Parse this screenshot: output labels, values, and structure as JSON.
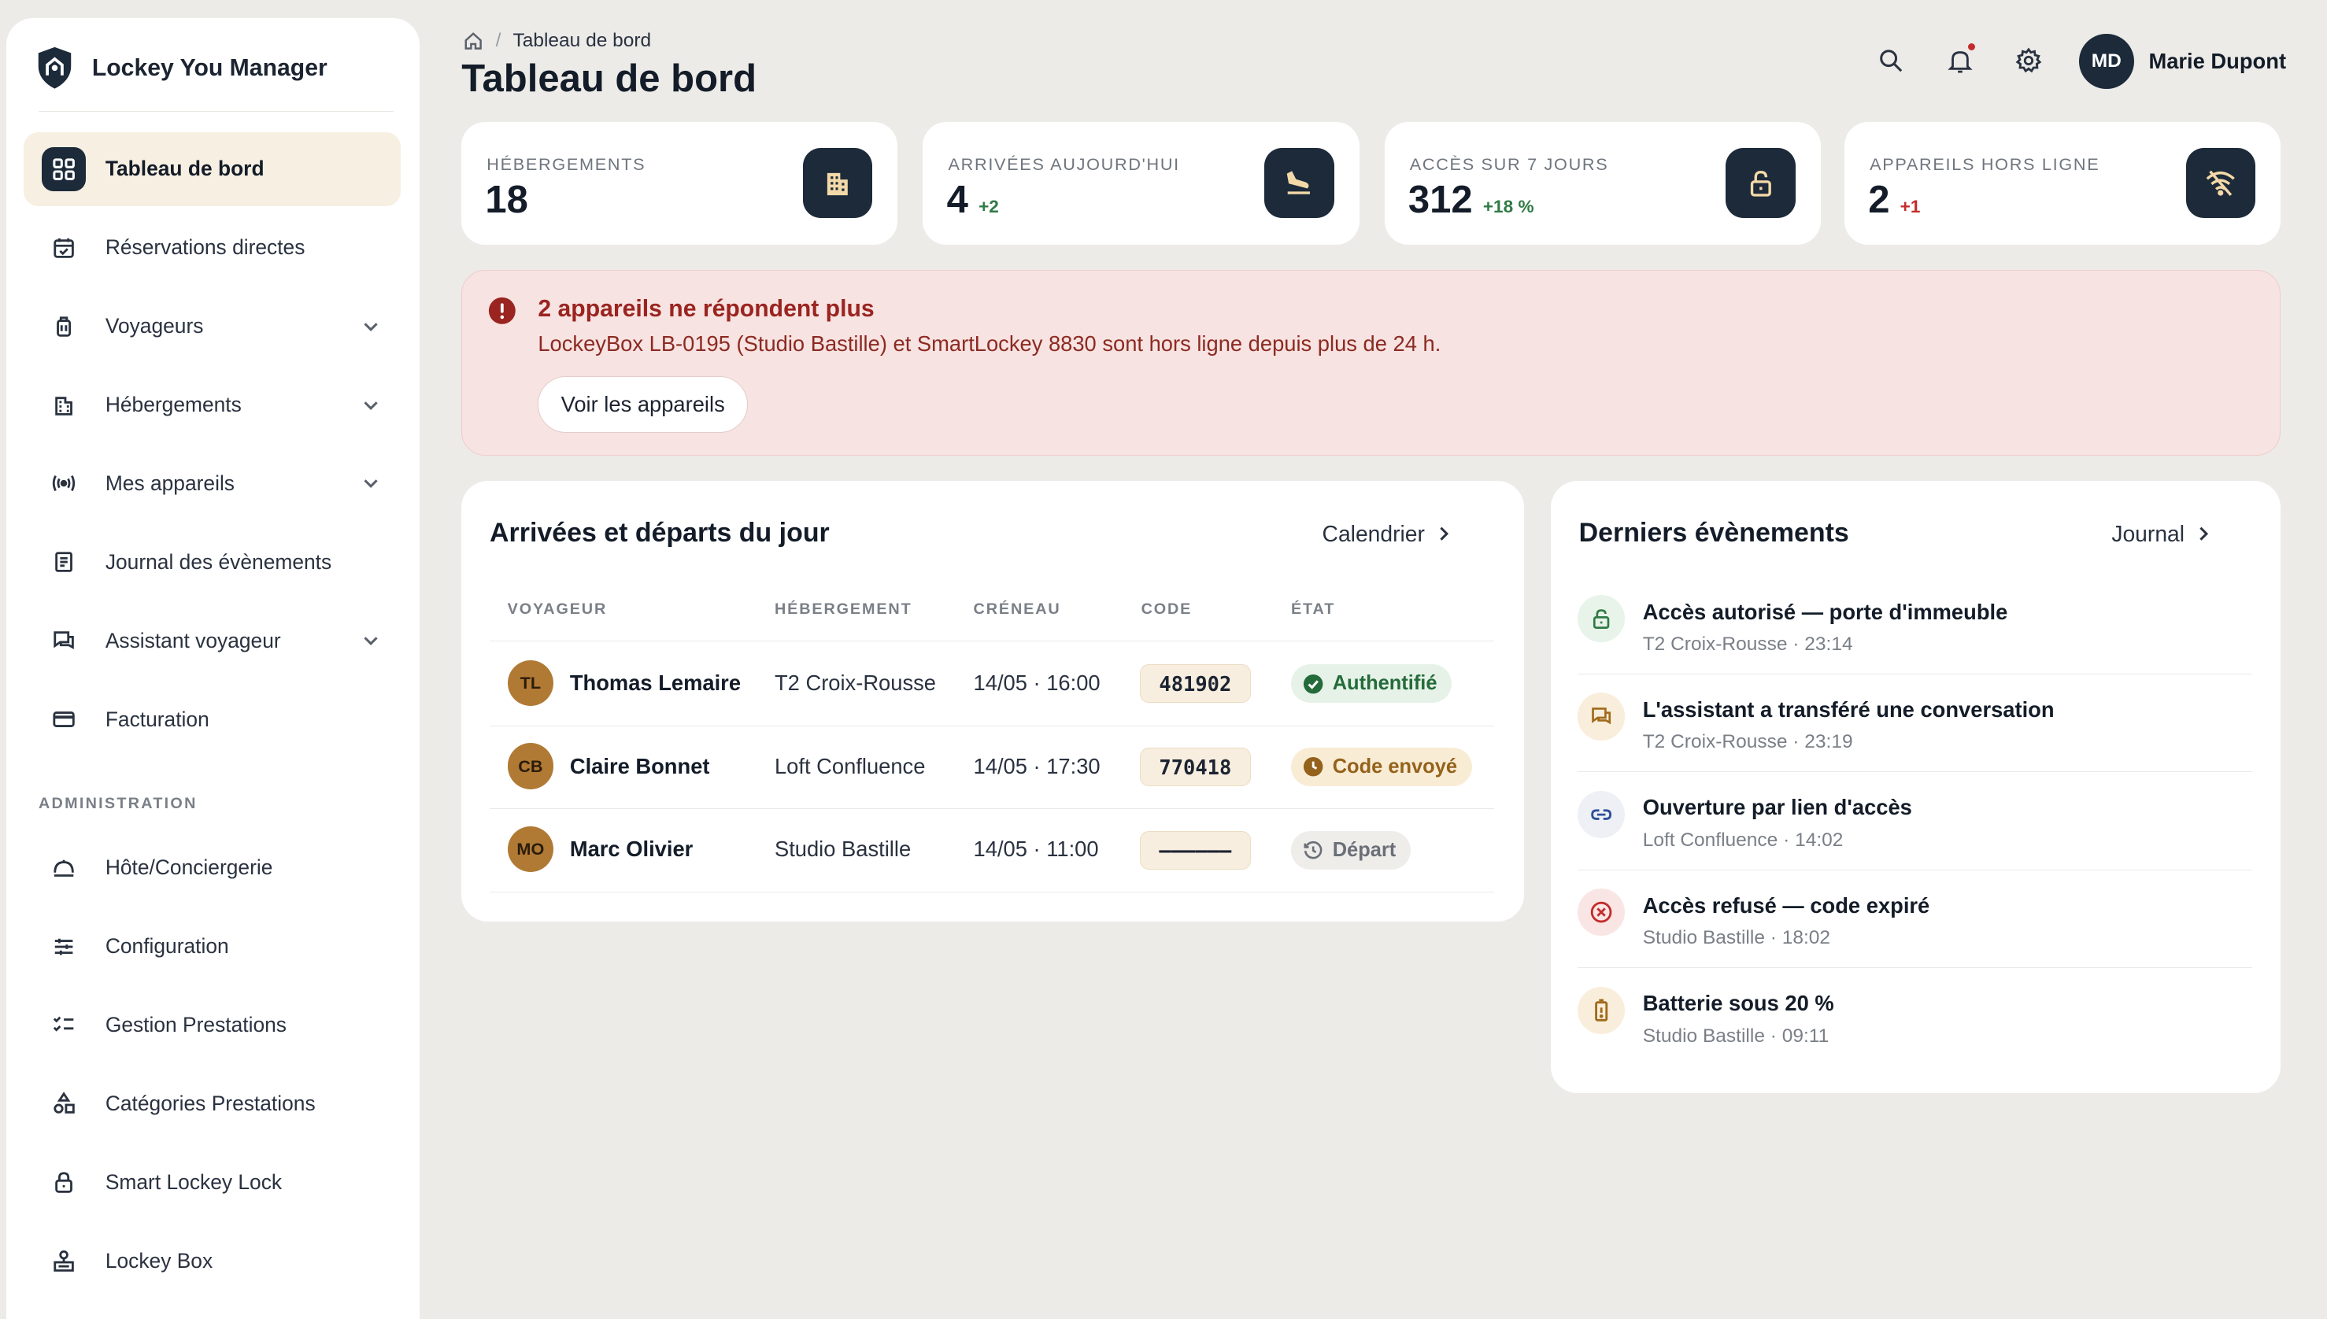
{
  "app": {
    "name": "Lockey You Manager"
  },
  "sidebar": {
    "items": [
      {
        "label": "Tableau de bord",
        "icon": "grid-icon",
        "active": true,
        "chevron": false
      },
      {
        "label": "Réservations directes",
        "icon": "calendar-check-icon",
        "chevron": false
      },
      {
        "label": "Voyageurs",
        "icon": "luggage-icon",
        "chevron": true
      },
      {
        "label": "Hébergements",
        "icon": "building-icon",
        "chevron": true
      },
      {
        "label": "Mes appareils",
        "icon": "signal-icon",
        "chevron": true
      },
      {
        "label": "Journal des évènements",
        "icon": "journal-icon",
        "chevron": false
      },
      {
        "label": "Assistant voyageur",
        "icon": "chat-icon",
        "chevron": true
      },
      {
        "label": "Facturation",
        "icon": "credit-card-icon",
        "chevron": false
      }
    ],
    "section_admin": "ADMINISTRATION",
    "admin_items": [
      {
        "label": "Hôte/Conciergerie",
        "icon": "concierge-icon"
      },
      {
        "label": "Configuration",
        "icon": "sliders-icon"
      },
      {
        "label": "Gestion Prestations",
        "icon": "checklist-icon"
      },
      {
        "label": "Catégories Prestations",
        "icon": "shapes-icon"
      },
      {
        "label": "Smart Lockey Lock",
        "icon": "lock-icon"
      },
      {
        "label": "Lockey Box",
        "icon": "key-box-icon"
      }
    ]
  },
  "header": {
    "breadcrumb": "Tableau de bord",
    "title": "Tableau de bord",
    "user": {
      "initials": "MD",
      "name": "Marie Dupont"
    }
  },
  "stats": [
    {
      "label": "HÉBERGEMENTS",
      "value": "18",
      "delta": "",
      "icon": "building-icon"
    },
    {
      "label": "ARRIVÉES AUJOURD'HUI",
      "value": "4",
      "delta": "+2",
      "delta_color": "#2f7a45",
      "icon": "plane-landing-icon"
    },
    {
      "label": "ACCÈS SUR 7 JOURS",
      "value": "312",
      "delta": "+18 %",
      "delta_color": "#2f7a45",
      "icon": "unlock-icon"
    },
    {
      "label": "APPAREILS HORS LIGNE",
      "value": "2",
      "delta": "+1",
      "delta_color": "#c42b2b",
      "icon": "wifi-off-icon"
    }
  ],
  "alert": {
    "title": "2 appareils ne répondent plus",
    "text": "LockeyBox LB-0195 (Studio Bastille) et SmartLockey 8830 sont hors ligne depuis plus de 24 h.",
    "button": "Voir les appareils"
  },
  "arrivals": {
    "title": "Arrivées et départs du jour",
    "link": "Calendrier",
    "columns": [
      "VOYAGEUR",
      "HÉBERGEMENT",
      "CRÉNEAU",
      "CODE",
      "ÉTAT"
    ],
    "rows": [
      {
        "initials": "TL",
        "guest": "Thomas Lemaire",
        "lodging": "T2 Croix-Rousse",
        "slot": "14/05 · 16:00",
        "code": "481902",
        "status": "Authentifié",
        "status_kind": "ok"
      },
      {
        "initials": "CB",
        "guest": "Claire Bonnet",
        "lodging": "Loft Confluence",
        "slot": "14/05 · 17:30",
        "code": "770418",
        "status": "Code envoyé",
        "status_kind": "pending"
      },
      {
        "initials": "MO",
        "guest": "Marc Olivier",
        "lodging": "Studio Bastille",
        "slot": "14/05 · 11:00",
        "code": "——————",
        "status": "Départ",
        "status_kind": "done"
      }
    ]
  },
  "events": {
    "title": "Derniers évènements",
    "link": "Journal",
    "items": [
      {
        "title": "Accès autorisé — porte d'immeuble",
        "sub": "T2 Croix-Rousse · 23:14",
        "icon": "unlock-icon",
        "kind": "ok"
      },
      {
        "title": "L'assistant a transféré une conversation",
        "sub": "T2 Croix-Rousse · 23:19",
        "icon": "chat-icon",
        "kind": "warn"
      },
      {
        "title": "Ouverture par lien d'accès",
        "sub": "Loft Confluence · 14:02",
        "icon": "link-icon",
        "kind": "info"
      },
      {
        "title": "Accès refusé — code expiré",
        "sub": "Studio Bastille · 18:02",
        "icon": "x-circle-icon",
        "kind": "error"
      },
      {
        "title": "Batterie sous 20 %",
        "sub": "Studio Bastille · 09:11",
        "icon": "battery-low-icon",
        "kind": "warn"
      }
    ]
  },
  "colors": {
    "navy": "#1c2a3a",
    "accent_bg": "#f7efe2",
    "alert_bg": "#f7e3e1",
    "alert_text": "#9a2420"
  }
}
